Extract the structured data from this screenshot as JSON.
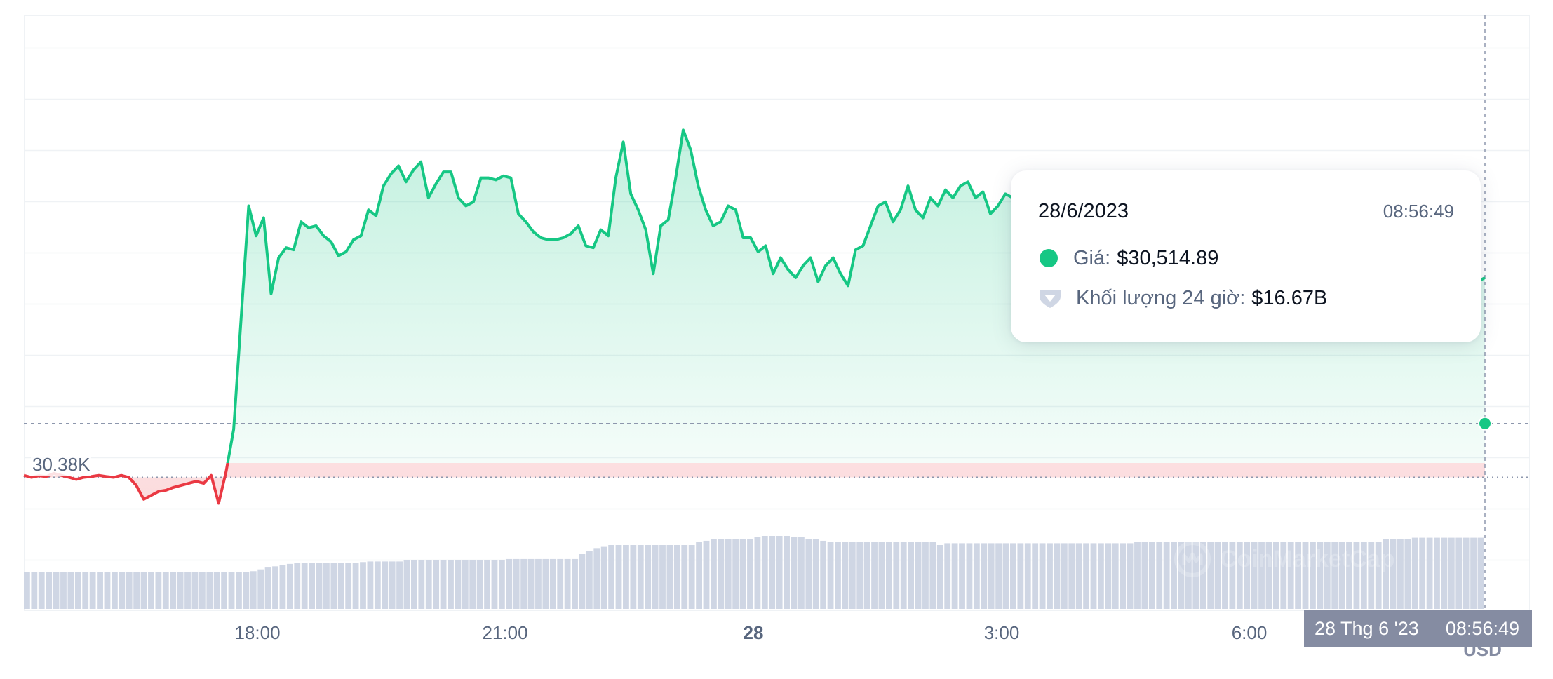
{
  "chart_data": {
    "type": "line",
    "currency": "USD",
    "baseline_label": "30.38K",
    "x_ticks": [
      {
        "label": "18:00",
        "bold": false
      },
      {
        "label": "21:00",
        "bold": false
      },
      {
        "label": "28",
        "bold": true
      },
      {
        "label": "3:00",
        "bold": false
      },
      {
        "label": "6:00",
        "bold": false
      }
    ],
    "price_series": {
      "name": "Giá",
      "values": [
        30385,
        30380,
        30384,
        30382,
        30390,
        30385,
        30380,
        30375,
        30380,
        30382,
        30385,
        30382,
        30380,
        30385,
        30380,
        30360,
        30325,
        30335,
        30345,
        30348,
        30355,
        30360,
        30365,
        30370,
        30365,
        30385,
        30315,
        30395,
        30500,
        30780,
        31060,
        30985,
        31030,
        30840,
        30930,
        30955,
        30950,
        31020,
        31005,
        31010,
        30985,
        30970,
        30935,
        30945,
        30975,
        30985,
        31050,
        31035,
        31110,
        31140,
        31160,
        31120,
        31150,
        31170,
        31080,
        31115,
        31145,
        31145,
        31080,
        31060,
        31070,
        31130,
        31130,
        31125,
        31135,
        31130,
        31040,
        31020,
        30995,
        30980,
        30975,
        30975,
        30980,
        30990,
        31010,
        30960,
        30955,
        31000,
        30985,
        31130,
        31220,
        31090,
        31050,
        31000,
        30890,
        31010,
        31025,
        31130,
        31250,
        31200,
        31110,
        31050,
        31010,
        31020,
        31060,
        31050,
        30980,
        30980,
        30945,
        30960,
        30890,
        30930,
        30900,
        30880,
        30910,
        30930,
        30870,
        30910,
        30930,
        30890,
        30860,
        30950,
        30960,
        31010,
        31060,
        31070,
        31020,
        31050,
        31110,
        31050,
        31030,
        31080,
        31060,
        31100,
        31080,
        31110,
        31120,
        31080,
        31095,
        31040,
        31060,
        31090,
        31080,
        31080,
        31095,
        31060,
        31050,
        31030,
        31040,
        31060,
        31090,
        31060,
        31040,
        30990,
        31035,
        31050,
        31040,
        31055,
        31080,
        31095,
        31060,
        31080,
        31065,
        31100,
        31090,
        31070,
        30965,
        30935,
        30960,
        30990,
        30975,
        30900,
        30945,
        31000,
        30995,
        30990,
        31020,
        31050,
        31060,
        31040,
        31090,
        31030,
        31060,
        31050,
        31000,
        30985,
        30970,
        30960,
        30950,
        30955,
        31000,
        31010,
        31020,
        30990,
        30880,
        30920,
        30950,
        30880,
        30930,
        30940,
        30960,
        30920,
        30880,
        30850,
        30870,
        30880
      ],
      "baseline": 30380,
      "current": 30514.89
    },
    "volume_series": {
      "name": "Khối lượng 24 giờ",
      "unit": "billion USD",
      "values": [
        16.1,
        16.1,
        16.1,
        16.1,
        16.1,
        16.1,
        16.1,
        16.1,
        16.1,
        16.1,
        16.1,
        16.1,
        16.1,
        16.1,
        16.1,
        16.1,
        16.1,
        16.1,
        16.1,
        16.1,
        16.1,
        16.1,
        16.1,
        16.1,
        16.1,
        16.1,
        16.1,
        16.1,
        16.1,
        16.1,
        16.1,
        16.12,
        16.15,
        16.18,
        16.2,
        16.22,
        16.24,
        16.25,
        16.25,
        16.25,
        16.25,
        16.25,
        16.25,
        16.25,
        16.25,
        16.25,
        16.27,
        16.28,
        16.28,
        16.28,
        16.28,
        16.28,
        16.3,
        16.3,
        16.3,
        16.3,
        16.3,
        16.3,
        16.3,
        16.3,
        16.3,
        16.3,
        16.3,
        16.3,
        16.3,
        16.3,
        16.32,
        16.32,
        16.32,
        16.32,
        16.32,
        16.32,
        16.32,
        16.32,
        16.32,
        16.32,
        16.4,
        16.45,
        16.5,
        16.52,
        16.55,
        16.55,
        16.55,
        16.55,
        16.55,
        16.55,
        16.55,
        16.55,
        16.55,
        16.55,
        16.55,
        16.55,
        16.6,
        16.62,
        16.65,
        16.65,
        16.65,
        16.65,
        16.65,
        16.65,
        16.68,
        16.7,
        16.7,
        16.7,
        16.7,
        16.68,
        16.68,
        16.65,
        16.65,
        16.62,
        16.6,
        16.6,
        16.6,
        16.6,
        16.6,
        16.6,
        16.6,
        16.6,
        16.6,
        16.6,
        16.6,
        16.6,
        16.6,
        16.6,
        16.6,
        16.55,
        16.58,
        16.58,
        16.58,
        16.58,
        16.58,
        16.58,
        16.58,
        16.58,
        16.58,
        16.58,
        16.58,
        16.58,
        16.58,
        16.58,
        16.58,
        16.58,
        16.58,
        16.58,
        16.58,
        16.58,
        16.58,
        16.58,
        16.58,
        16.58,
        16.58,
        16.58,
        16.6,
        16.6,
        16.6,
        16.6,
        16.6,
        16.6,
        16.6,
        16.6,
        16.6,
        16.6,
        16.6,
        16.6,
        16.6,
        16.6,
        16.6,
        16.6,
        16.6,
        16.6,
        16.6,
        16.6,
        16.6,
        16.6,
        16.6,
        16.6,
        16.6,
        16.6,
        16.6,
        16.6,
        16.6,
        16.6,
        16.6,
        16.6,
        16.6,
        16.6,
        16.65,
        16.65,
        16.65,
        16.65,
        16.67,
        16.67,
        16.67,
        16.67,
        16.67,
        16.67,
        16.67,
        16.67,
        16.67,
        16.67
      ]
    },
    "colors": {
      "up": "#16c784",
      "down": "#ea3943",
      "grid": "#eff2f5",
      "volume_bar": "#cfd6e4",
      "crosshair": "#8d97ad"
    },
    "grid": true,
    "legend": "none"
  },
  "tooltip": {
    "date": "28/6/2023",
    "time": "08:56:49",
    "price_label": "Giá:",
    "price_value": "$30,514.89",
    "volume_label": "Khối lượng 24 giờ:",
    "volume_value": "$16.67B",
    "volume_icon": "diamond-shield-icon"
  },
  "crosshair": {
    "date_label": "28 Thg 6 '23",
    "time_label": "08:56:49"
  },
  "watermark": {
    "text": "CoinMarketCap",
    "icon": "coinmarketcap-logo-icon"
  }
}
